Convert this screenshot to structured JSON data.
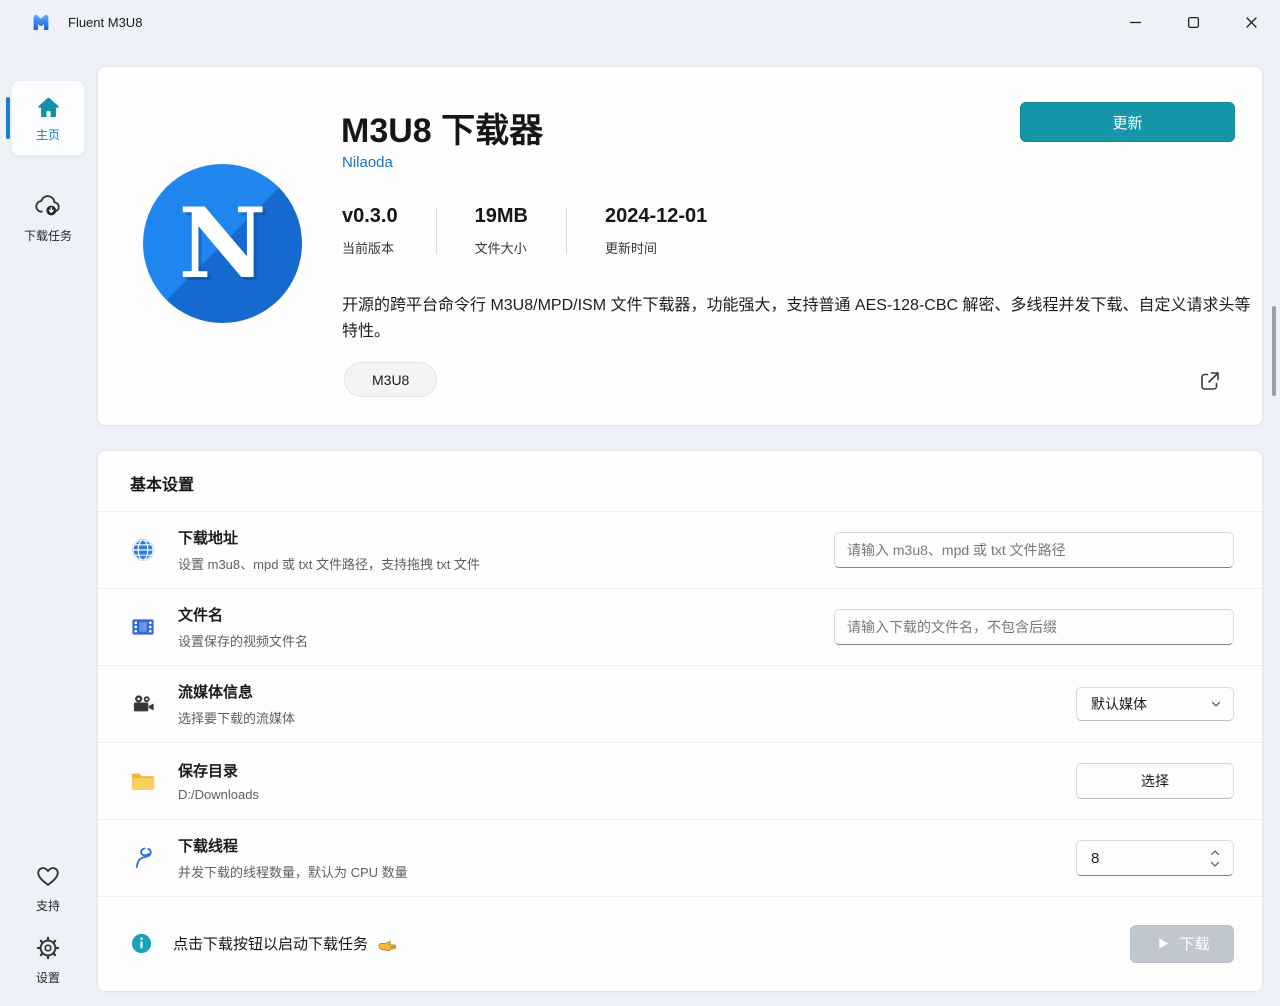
{
  "colors": {
    "accent_teal": "#1596a9",
    "logo_blue": "#1d82e8",
    "folder_yellow": "#f6c244",
    "link_blue": "#1873c4"
  },
  "titlebar": {
    "app_title": "Fluent M3U8"
  },
  "sidebar": {
    "items": [
      {
        "label": "主页",
        "icon": "home-icon",
        "active": true
      },
      {
        "label": "下载任务",
        "icon": "cloud-download-icon",
        "active": false
      }
    ],
    "bottom_items": [
      {
        "label": "支持",
        "icon": "heart-icon"
      },
      {
        "label": "设置",
        "icon": "gear-icon"
      }
    ]
  },
  "hero": {
    "logo_letter": "N",
    "title": "M3U8 下载器",
    "author": "Nilaoda",
    "stats": [
      {
        "value": "v0.3.0",
        "label": "当前版本"
      },
      {
        "value": "19MB",
        "label": "文件大小"
      },
      {
        "value": "2024-12-01",
        "label": "更新时间"
      }
    ],
    "description": "开源的跨平台命令行 M3U8/MPD/ISM 文件下载器，功能强大，支持普通 AES-128-CBC 解密、多线程并发下载、自定义请求头等特性。",
    "tag": "M3U8",
    "update_button": "更新",
    "share_icon": "share-icon"
  },
  "settings": {
    "section_title": "基本设置",
    "rows": [
      {
        "icon": "globe-icon",
        "title": "下载地址",
        "subtitle": "设置 m3u8、mpd 或 txt 文件路径，支持拖拽 txt 文件",
        "control": {
          "type": "text-input",
          "placeholder": "请输入 m3u8、mpd 或 txt 文件路径",
          "value": ""
        }
      },
      {
        "icon": "film-icon",
        "title": "文件名",
        "subtitle": "设置保存的视频文件名",
        "control": {
          "type": "text-input",
          "placeholder": "请输入下载的文件名，不包含后缀",
          "value": ""
        }
      },
      {
        "icon": "movie-camera-icon",
        "title": "流媒体信息",
        "subtitle": "选择要下载的流媒体",
        "control": {
          "type": "select",
          "value": "默认媒体"
        }
      },
      {
        "icon": "folder-icon",
        "title": "保存目录",
        "subtitle": "D:/Downloads",
        "control": {
          "type": "button",
          "label": "选择"
        }
      },
      {
        "icon": "thread-icon",
        "title": "下载线程",
        "subtitle": "并发下载的线程数量，默认为 CPU 数量",
        "control": {
          "type": "number-input",
          "value": "8"
        }
      }
    ],
    "footer": {
      "icon": "info-icon",
      "text": "点击下载按钮以启动下载任务",
      "pointer_icon": "pointing-right-hand-icon",
      "download_button": {
        "label": "下载",
        "icon": "play-icon",
        "disabled": true
      }
    }
  }
}
